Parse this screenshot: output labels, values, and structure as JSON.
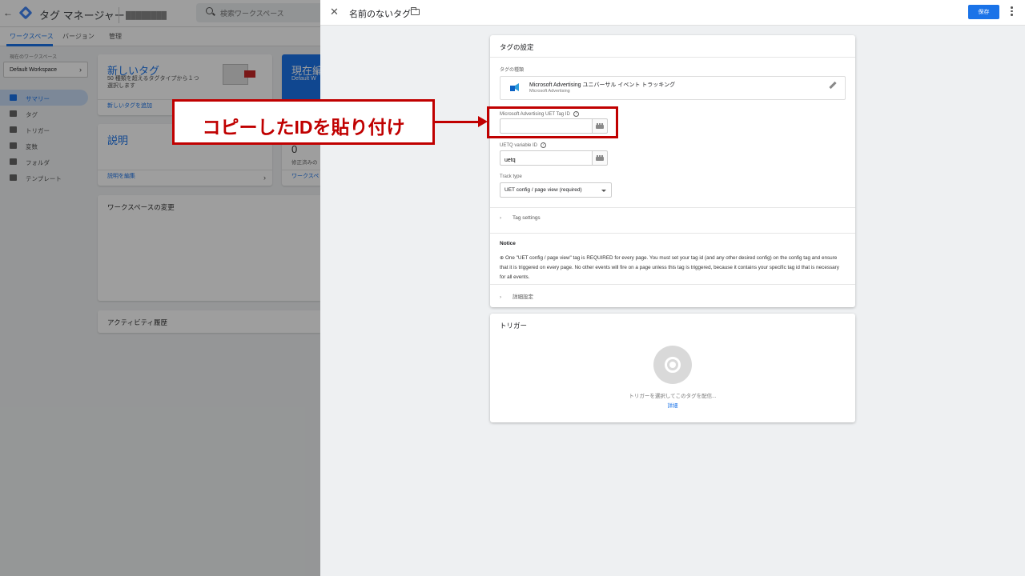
{
  "background_app": {
    "app_name": "タグ マネージャー",
    "account_placeholder": "████████",
    "search_placeholder": "検索ワークスペース",
    "tabs": [
      "ワークスペース",
      "バージョン",
      "管理"
    ],
    "workspace_label": "現在のワークスペース",
    "workspace_name": "Default Workspace",
    "nav_items": [
      "サマリー",
      "タグ",
      "トリガー",
      "変数",
      "フォルダ",
      "テンプレート"
    ],
    "new_tag_title": "新しいタグ",
    "new_tag_sub": "50 種類を超えるタグタイプから１つ選択します",
    "new_tag_link": "新しいタグを追加",
    "current_edit_title": "現在編",
    "current_edit_sub": "Default W",
    "description_title": "説明",
    "description_link": "説明を編集",
    "changes_count": "0",
    "changes_sub": "修正済みの",
    "changes_link": "ワークスペ",
    "workspace_changes_title": "ワークスペースの変更",
    "activity_title": "アクティビティ履歴"
  },
  "panel": {
    "tag_name": "名前のないタグ",
    "save_label": "保存",
    "config_card": {
      "header": "タグの設定",
      "tag_type_label": "タグの種類",
      "tag_type_name": "Microsoft Advertising ユニバーサル イベント トラッキング",
      "tag_type_sub": "Microsoft Advertising",
      "uet_tag_id_label": "Microsoft Advertising UET Tag ID",
      "uet_tag_id_value": "",
      "uetq_label": "UETQ variable ID",
      "uetq_value": "uetq",
      "track_type_label": "Track type",
      "track_type_value": "UET config / page view (required)",
      "tag_settings_label": "Tag settings",
      "notice_title": "Notice",
      "notice_body": "⊕ One \"UET config / page view\" tag is REQUIRED for every page. You must set your tag id (and any other desired config) on the config tag and ensure that it is triggered on every page. No other events will fire on a page unless this tag is triggered, because it contains your specific tag id that is necessary for all events.",
      "advanced_label": "詳細設定"
    },
    "trigger_card": {
      "title": "トリガー",
      "empty_text": "トリガーを選択してこのタグを配信...",
      "link": "詳細"
    }
  },
  "annotation": {
    "text": "コピーしたIDを貼り付け",
    "color": "#c00000"
  },
  "colors": {
    "accent": "#1a73e8",
    "annotation": "#c00000"
  }
}
